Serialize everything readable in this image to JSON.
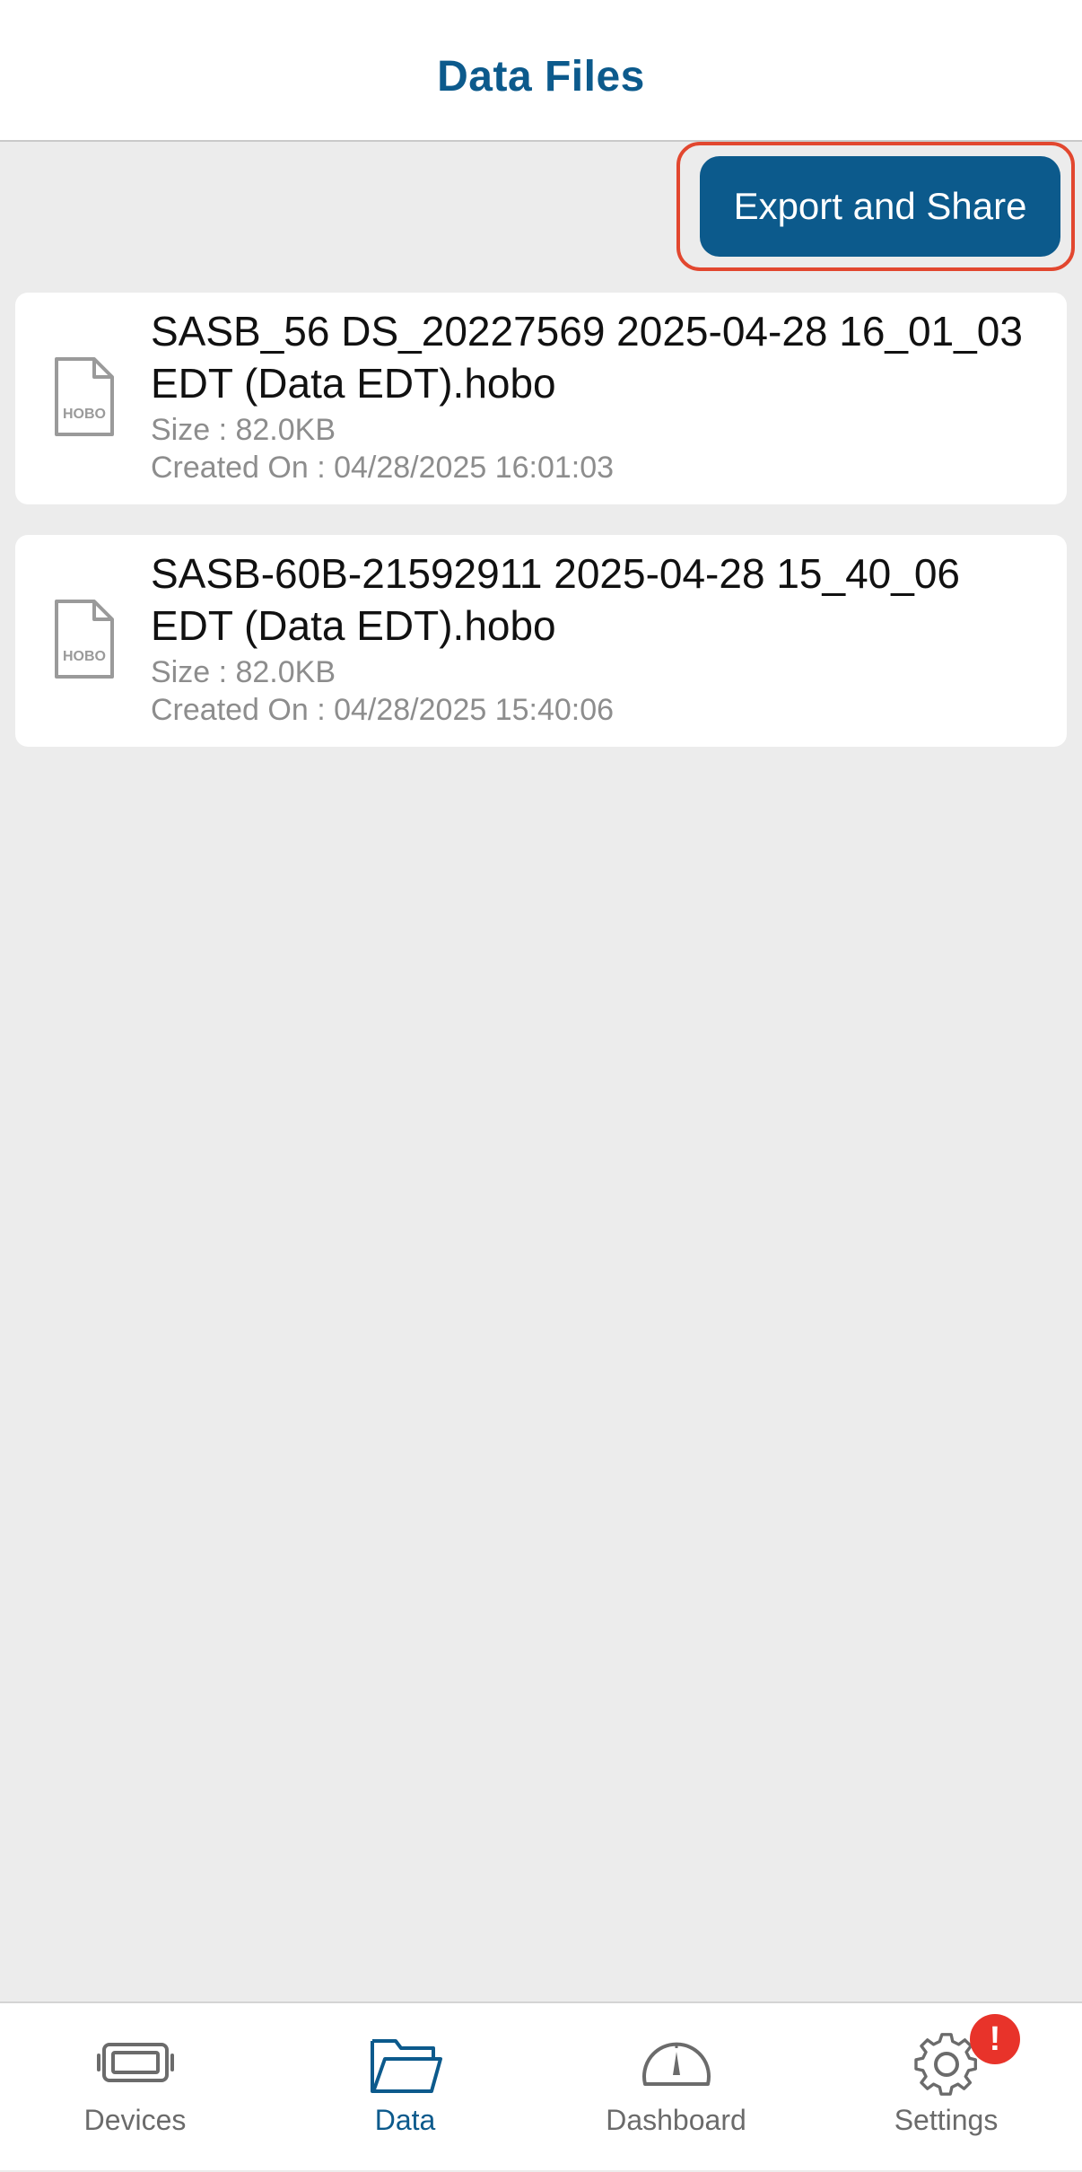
{
  "header": {
    "title": "Data Files"
  },
  "toolbar": {
    "export_label": "Export and Share"
  },
  "files": [
    {
      "name": "SASB_56 DS_20227569 2025-04-28 16_01_03 EDT (Data EDT).hobo",
      "size": "Size : 82.0KB",
      "created": "Created On : 04/28/2025 16:01:03",
      "icon": "hobo-file-icon"
    },
    {
      "name": "SASB-60B-21592911 2025-04-28 15_40_06 EDT (Data EDT).hobo",
      "size": "Size : 82.0KB",
      "created": "Created On : 04/28/2025 15:40:06",
      "icon": "hobo-file-icon"
    }
  ],
  "tabbar": {
    "tabs": [
      {
        "label": "Devices",
        "icon": "devices-icon",
        "active": false
      },
      {
        "label": "Data",
        "icon": "folder-icon",
        "active": true
      },
      {
        "label": "Dashboard",
        "icon": "gauge-icon",
        "active": false
      },
      {
        "label": "Settings",
        "icon": "gear-icon",
        "active": false
      }
    ],
    "settings_badge": "!"
  },
  "colors": {
    "brand": "#0c5a8c",
    "highlight": "#e2472f",
    "badge": "#e8332a",
    "background": "#ececec"
  }
}
